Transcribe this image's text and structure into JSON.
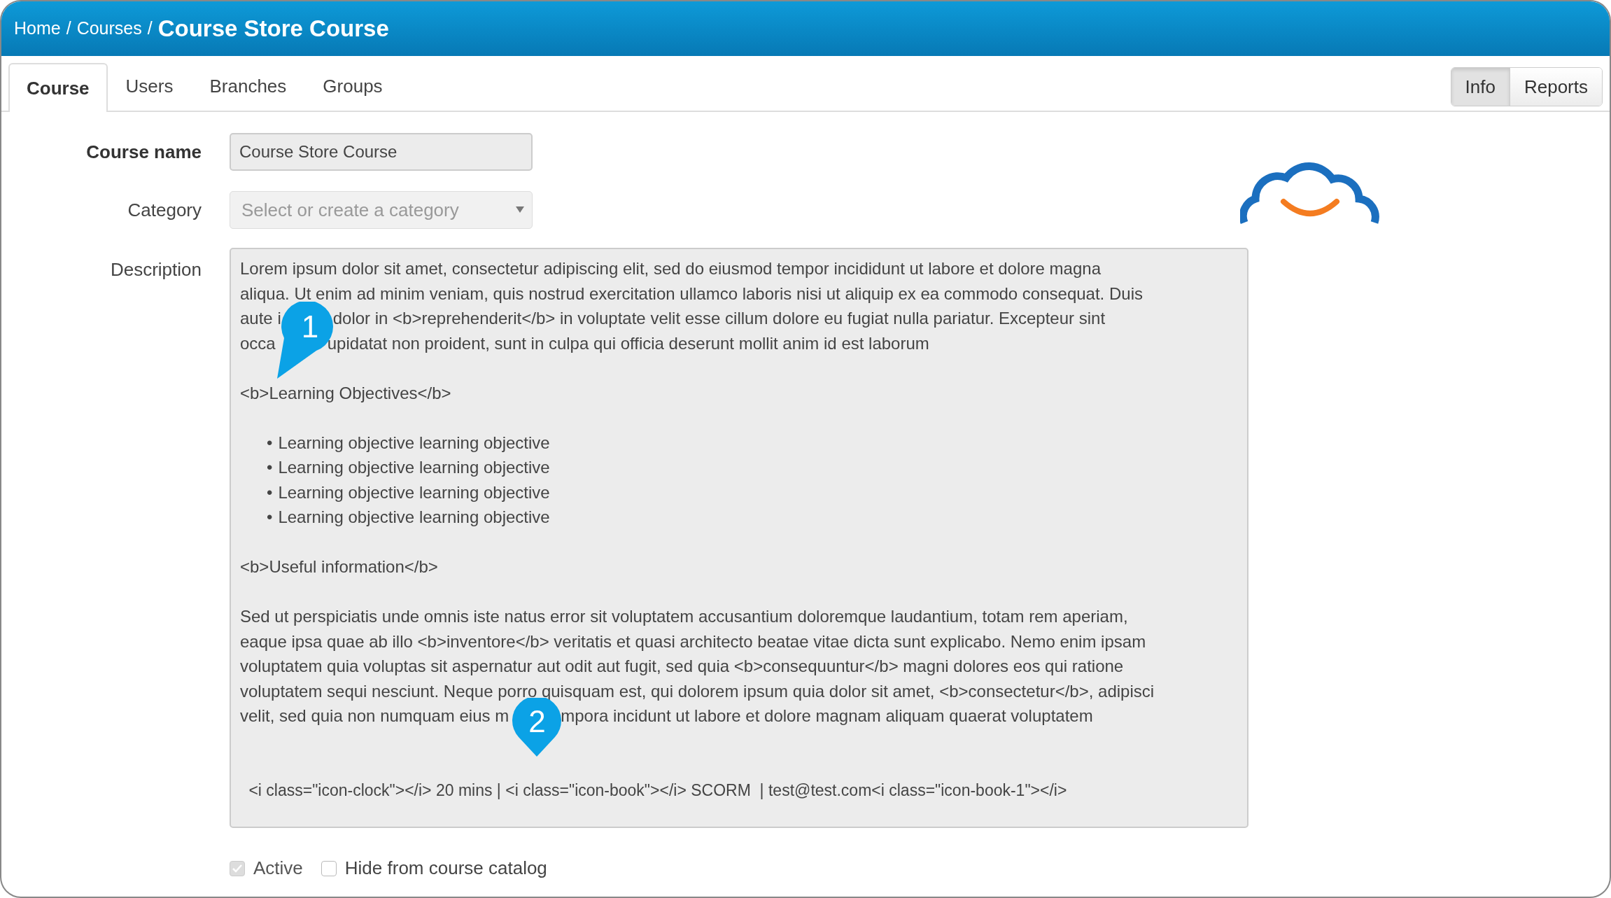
{
  "breadcrumb": {
    "links": [
      "Home",
      "Courses"
    ],
    "separator": "/",
    "current": "Course Store Course"
  },
  "tabs": [
    {
      "label": "Course",
      "selected": true
    },
    {
      "label": "Users",
      "selected": false
    },
    {
      "label": "Branches",
      "selected": false
    },
    {
      "label": "Groups",
      "selected": false
    }
  ],
  "view_buttons": [
    {
      "label": "Info",
      "selected": true
    },
    {
      "label": "Reports",
      "selected": false
    }
  ],
  "course_name": {
    "label": "Course name",
    "value": "Course Store Course"
  },
  "category": {
    "label": "Category",
    "placeholder": "Select or create a category"
  },
  "description": {
    "label": "Description",
    "lines": [
      {
        "kind": "text",
        "parts": [
          "Lorem ipsum dolor sit amet, consectetur adipiscing elit, sed do eiusmod tempor incididunt ut labore et dolore magna"
        ]
      },
      {
        "kind": "text",
        "parts": [
          "aliqua. Ut enim ad minim veniam, quis nostrud exercitation ullamco laboris nisi ut aliquip ex ea commodo consequat. Duis"
        ]
      },
      {
        "kind": "text",
        "parts": [
          "aute i",
          "dolor in <b>reprehenderit</b> in voluptate velit esse cillum dolore eu fugiat nulla pariatur. Excepteur sint"
        ],
        "callout": "1"
      },
      {
        "kind": "text",
        "parts": [
          "occa",
          "upidatat non proident, sunt in culpa qui officia deserunt mollit anim id est laborum"
        ]
      },
      {
        "kind": "blank"
      },
      {
        "kind": "text",
        "parts": [
          "<b>Learning Objectives</b>"
        ]
      },
      {
        "kind": "blank"
      },
      {
        "kind": "bullet",
        "parts": [
          "Learning objective learning objective"
        ],
        "bullet": "•"
      },
      {
        "kind": "bullet",
        "parts": [
          "Learning objective learning objective"
        ],
        "bullet": "•"
      },
      {
        "kind": "bullet",
        "parts": [
          "Learning objective learning objective"
        ],
        "bullet": "•"
      },
      {
        "kind": "bullet",
        "parts": [
          "Learning objective learning objective"
        ],
        "bullet": "•"
      },
      {
        "kind": "blank"
      },
      {
        "kind": "text",
        "parts": [
          "<b>Useful information</b>"
        ]
      },
      {
        "kind": "blank"
      },
      {
        "kind": "text",
        "parts": [
          "Sed ut perspiciatis unde omnis iste natus error sit voluptatem accusantium doloremque laudantium, totam rem aperiam,"
        ]
      },
      {
        "kind": "text",
        "parts": [
          "eaque ipsa quae ab illo <b>inventore</b> veritatis et quasi architecto beatae vitae dicta sunt explicabo. Nemo enim ipsam"
        ]
      },
      {
        "kind": "text",
        "parts": [
          "voluptatem quia voluptas sit aspernatur aut odit aut fugit, sed quia <b>consequuntur</b> magni dolores eos qui ratione"
        ]
      },
      {
        "kind": "text",
        "parts": [
          "voluptatem sequi nesciunt. Neque porro quisquam est, qui dolorem ipsum quia dolor sit amet, <b>consectetur</b>, adipisci"
        ]
      },
      {
        "kind": "text",
        "parts": [
          "velit, sed quia non numquam eius m",
          "mpora incidunt ut labore et dolore magnam aliquam quaerat voluptatem"
        ],
        "callout": "2"
      },
      {
        "kind": "blank"
      },
      {
        "kind": "blank"
      },
      {
        "kind": "code",
        "parts": [
          " <i class=\"icon-clock\"></i> 20 mins | <i class=\"icon-book\"></i> SCORM  | test@test.com<i class=\"icon-book-1\"></i>"
        ]
      }
    ]
  },
  "checkboxes": [
    {
      "label": "Active",
      "checked": true,
      "disabled": true
    },
    {
      "label": "Hide from course catalog",
      "checked": false,
      "disabled": false
    }
  ]
}
